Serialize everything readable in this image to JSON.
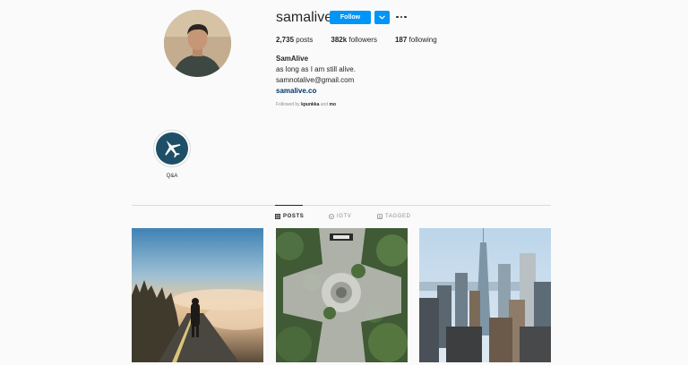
{
  "profile": {
    "username": "samalive",
    "follow_label": "Follow",
    "stats": {
      "posts_count": "2,735",
      "posts_label": " posts",
      "followers_count": "382k",
      "followers_label": " followers",
      "following_count": "187",
      "following_label": " following"
    },
    "full_name": "SamAlive",
    "bio_line1": "as long as I am still alive.",
    "bio_line2": "samnotalive@gmail.com",
    "website": "samalive.co",
    "followed_by_prefix": "Followed by ",
    "followed_by_user1": "kpunkka",
    "followed_by_and": " and ",
    "followed_by_user2": "mo"
  },
  "highlights": [
    {
      "label": "Q&A",
      "icon": "airplane-icon"
    }
  ],
  "tabs": [
    {
      "label": "POSTS",
      "icon": "grid-icon",
      "active": true
    },
    {
      "label": "IGTV",
      "icon": "igtv-icon",
      "active": false
    },
    {
      "label": "TAGGED",
      "icon": "tag-icon",
      "active": false
    }
  ],
  "posts": [
    {
      "subject": "misty road at sunrise"
    },
    {
      "subject": "aerial plaza with trees"
    },
    {
      "subject": "city skyline"
    }
  ],
  "colors": {
    "accent": "#0095f6",
    "link": "#00376b",
    "muted": "#8e8e8e",
    "border": "#dbdbdb"
  }
}
